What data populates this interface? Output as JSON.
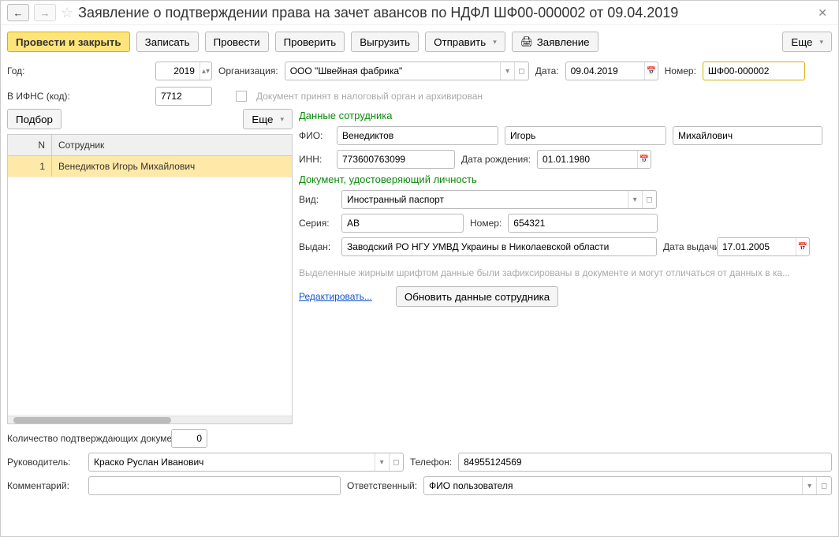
{
  "title": "Заявление о подтверждении права на зачет авансов по НДФЛ ШФ00-000002 от 09.04.2019",
  "toolbar": {
    "post_close": "Провести и закрыть",
    "write": "Записать",
    "post": "Провести",
    "check": "Проверить",
    "export": "Выгрузить",
    "send": "Отправить",
    "application": "Заявление",
    "more": "Еще"
  },
  "header": {
    "year_lbl": "Год:",
    "year": "2019",
    "org_lbl": "Организация:",
    "org": "ООО \"Швейная фабрика\"",
    "date_lbl": "Дата:",
    "date": "09.04.2019",
    "number_lbl": "Номер:",
    "number": "ШФ00-000002",
    "ifns_lbl": "В ИФНС (код):",
    "ifns": "7712",
    "archived_lbl": "Документ принят в налоговый орган и архивирован"
  },
  "left": {
    "pick": "Подбор",
    "more": "Еще",
    "col_n": "N",
    "col_emp": "Сотрудник",
    "rows": [
      {
        "n": "1",
        "emp": "Венедиктов Игорь Михайлович"
      }
    ]
  },
  "emp": {
    "section": "Данные сотрудника",
    "fio_lbl": "ФИО:",
    "last": "Венедиктов",
    "first": "Игорь",
    "middle": "Михайлович",
    "inn_lbl": "ИНН:",
    "inn": "773600763099",
    "dob_lbl": "Дата рождения:",
    "dob": "01.01.1980"
  },
  "doc": {
    "section": "Документ, удостоверяющий личность",
    "kind_lbl": "Вид:",
    "kind": "Иностранный паспорт",
    "series_lbl": "Серия:",
    "series": "АВ",
    "num_lbl": "Номер:",
    "num": "654321",
    "issued_lbl": "Выдан:",
    "issued": "Заводский РО НГУ УМВД Украины в Николаевской области",
    "issue_date_lbl": "Дата выдачи:",
    "issue_date": "17.01.2005"
  },
  "hint": "Выделенные жирным шрифтом данные были зафиксированы в документе и могут отличаться от данных в ка...",
  "edit_link": "Редактировать...",
  "update_btn": "Обновить данные сотрудника",
  "footer": {
    "count_lbl": "Количество подтверждающих документов:",
    "count": "0",
    "head_lbl": "Руководитель:",
    "head": "Краско Руслан Иванович",
    "phone_lbl": "Телефон:",
    "phone": "84955124569",
    "comment_lbl": "Комментарий:",
    "comment": "",
    "resp_lbl": "Ответственный:",
    "resp": "ФИО пользователя"
  }
}
